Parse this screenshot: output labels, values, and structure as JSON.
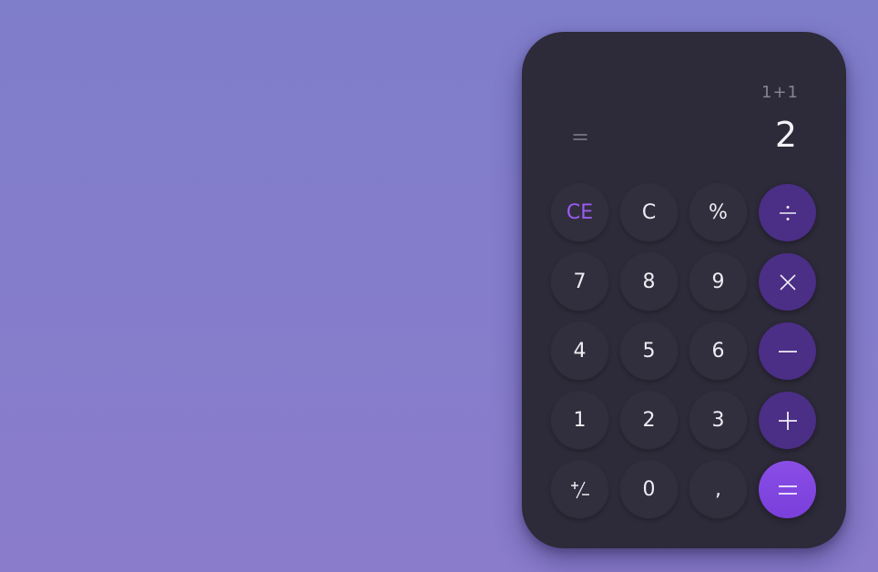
{
  "display": {
    "expression": "1+1",
    "equals_symbol": "=",
    "result": "2"
  },
  "keys": {
    "ce": "CE",
    "c": "C",
    "percent": "%",
    "seven": "7",
    "eight": "8",
    "nine": "9",
    "four": "4",
    "five": "5",
    "six": "6",
    "one": "1",
    "two": "2",
    "three": "3",
    "zero": "0",
    "comma": ","
  },
  "icons": {
    "divide": "divide-icon",
    "multiply": "multiply-icon",
    "minus": "minus-icon",
    "plus": "plus-icon",
    "plus_minus": "plus-minus-icon",
    "equals": "equals-icon"
  },
  "colors": {
    "background": "#8280cc",
    "calculator_body": "#2d2a39",
    "key": "#312e3d",
    "operator_key": "#4b2e86",
    "equals_key": "#8247e0",
    "accent_text": "#9a5cf2"
  }
}
